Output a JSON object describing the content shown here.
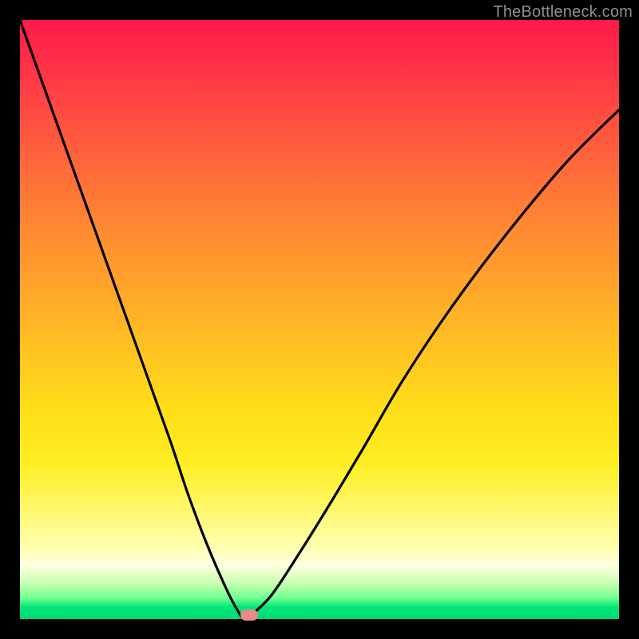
{
  "watermark": "TheBottleneck.com",
  "chart_data": {
    "type": "line",
    "title": "",
    "xlabel": "",
    "ylabel": "",
    "xlim": [
      0,
      100
    ],
    "ylim": [
      0,
      100
    ],
    "series": [
      {
        "name": "bottleneck-curve",
        "x": [
          0,
          5,
          10,
          15,
          20,
          25,
          28,
          31,
          34,
          36,
          37.5,
          39,
          42,
          46,
          51,
          57,
          64,
          72,
          81,
          91,
          100
        ],
        "values": [
          100,
          86,
          72,
          58,
          44,
          30,
          21,
          13,
          6,
          2,
          0,
          1,
          4,
          10,
          18,
          28,
          40,
          52,
          64,
          76,
          85
        ]
      }
    ],
    "marker": {
      "x": 38.2,
      "y": 0
    },
    "grid": false,
    "legend": false
  }
}
